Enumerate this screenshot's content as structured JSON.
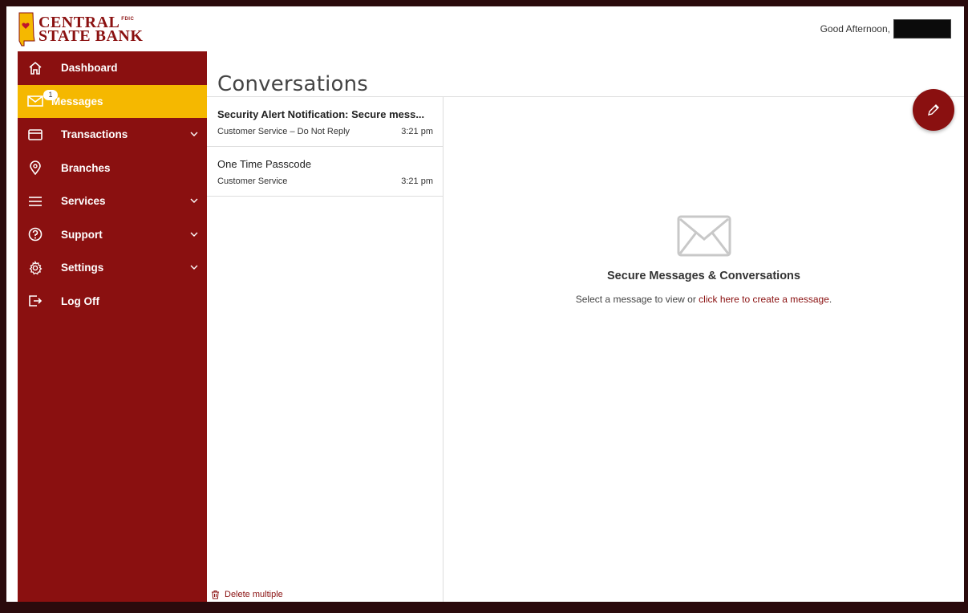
{
  "header": {
    "logo_line1": "CENTRAL",
    "logo_line2": "STATE BANK",
    "logo_fdic": "FDIC",
    "greeting": "Good Afternoon,"
  },
  "sidebar": {
    "items": [
      {
        "label": "Dashboard",
        "icon": "home-icon"
      },
      {
        "label": "Messages",
        "icon": "envelope-icon",
        "badge": "1",
        "active": true
      },
      {
        "label": "Transactions",
        "icon": "card-icon",
        "expandable": true
      },
      {
        "label": "Branches",
        "icon": "location-pin-icon"
      },
      {
        "label": "Services",
        "icon": "menu-icon",
        "expandable": true
      },
      {
        "label": "Support",
        "icon": "question-icon",
        "expandable": true
      },
      {
        "label": "Settings",
        "icon": "gear-icon",
        "expandable": true
      },
      {
        "label": "Log Off",
        "icon": "logout-icon"
      }
    ]
  },
  "main": {
    "title": "Conversations",
    "conversations": [
      {
        "subject": "Security Alert Notification: Secure mess...",
        "from": "Customer Service – Do Not Reply",
        "time": "3:21 pm",
        "unread": true
      },
      {
        "subject": "One Time Passcode",
        "from": "Customer Service",
        "time": "3:21 pm",
        "unread": false
      }
    ],
    "delete_multiple": "Delete multiple",
    "empty": {
      "heading": "Secure Messages & Conversations",
      "text_before": "Select a message to view or ",
      "link": "click here to create a message",
      "text_after": "."
    }
  },
  "colors": {
    "brand": "#8a1010",
    "accent": "#f5b800"
  }
}
